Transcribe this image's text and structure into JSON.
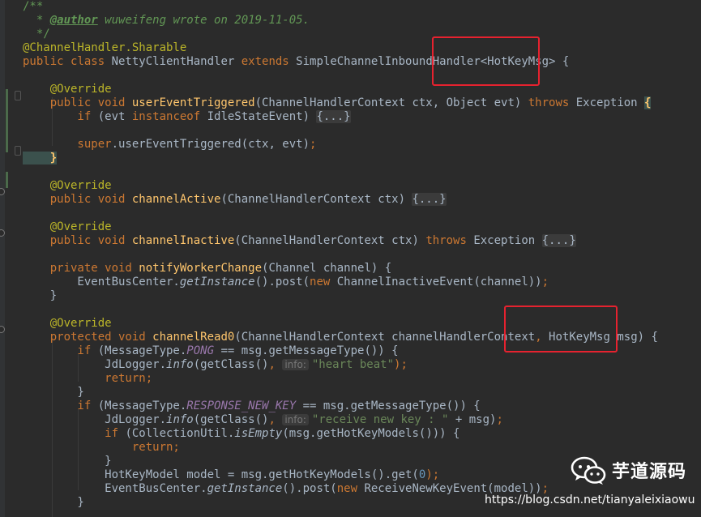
{
  "colors": {
    "background": "#2b2b2b",
    "text": "#a9b7c6",
    "keyword": "#cc7832",
    "method_decl": "#ffc66d",
    "annotation": "#bbb529",
    "string": "#6a8759",
    "number": "#6897bb",
    "static_field": "#9876aa",
    "doc_comment": "#629755",
    "hint_text": "#787878",
    "fold_bg": "#3b3b3b",
    "highlight_box": "#e6222f"
  },
  "code_lines": [
    [
      {
        "t": "/**",
        "c": "doc_comment"
      }
    ],
    [
      {
        "t": "  * ",
        "c": "doc_comment"
      },
      {
        "t": "@author",
        "c": "doc_comment",
        "s": "tag"
      },
      {
        "t": " wuweifeng wrote on 2019-11-05.",
        "c": "doc_comment",
        "s": "italic"
      }
    ],
    [
      {
        "t": "  */",
        "c": "doc_comment"
      }
    ],
    [
      {
        "t": "@ChannelHandler.",
        "c": "annotation"
      },
      {
        "t": "Sharable",
        "c": "annotation"
      }
    ],
    [
      {
        "t": "public class ",
        "c": "keyword"
      },
      {
        "t": "NettyClientHandler ",
        "c": "text"
      },
      {
        "t": "extends ",
        "c": "keyword"
      },
      {
        "t": "SimpleChannelInboundHandler<HotKeyMsg> {",
        "c": "text"
      }
    ],
    [],
    [
      {
        "t": "    @Override",
        "c": "annotation"
      }
    ],
    [
      {
        "t": "    public void ",
        "c": "keyword"
      },
      {
        "t": "userEventTriggered",
        "c": "method_decl"
      },
      {
        "t": "(ChannelHandlerContext ctx, Object evt) ",
        "c": "text"
      },
      {
        "t": "throws ",
        "c": "keyword"
      },
      {
        "t": "Exception ",
        "c": "text"
      },
      {
        "t": "{",
        "c": "method_decl",
        "s": "bold"
      }
    ],
    [
      {
        "t": "        if ",
        "c": "keyword"
      },
      {
        "t": "(evt ",
        "c": "text"
      },
      {
        "t": "instanceof ",
        "c": "keyword"
      },
      {
        "t": "IdleStateEvent) ",
        "c": "text"
      },
      {
        "t": "{...}",
        "c": "text",
        "s": "fold"
      }
    ],
    [],
    [
      {
        "t": "        super",
        "c": "keyword"
      },
      {
        "t": ".userEventTriggered(ctx, evt)",
        "c": "text"
      },
      {
        "t": ";",
        "c": "keyword"
      }
    ],
    [
      {
        "t": "    }",
        "c": "method_decl",
        "s": "bold"
      }
    ],
    [],
    [
      {
        "t": "    @Override",
        "c": "annotation"
      }
    ],
    [
      {
        "t": "    public void ",
        "c": "keyword"
      },
      {
        "t": "channelActive",
        "c": "method_decl"
      },
      {
        "t": "(ChannelHandlerContext ctx) ",
        "c": "text"
      },
      {
        "t": "{...}",
        "c": "text",
        "s": "fold"
      }
    ],
    [],
    [
      {
        "t": "    @Override",
        "c": "annotation"
      }
    ],
    [
      {
        "t": "    public void ",
        "c": "keyword"
      },
      {
        "t": "channelInactive",
        "c": "method_decl"
      },
      {
        "t": "(ChannelHandlerContext ctx) ",
        "c": "text"
      },
      {
        "t": "throws ",
        "c": "keyword"
      },
      {
        "t": "Exception ",
        "c": "text"
      },
      {
        "t": "{...}",
        "c": "text",
        "s": "fold"
      }
    ],
    [],
    [
      {
        "t": "    private void ",
        "c": "keyword"
      },
      {
        "t": "notifyWorkerChange",
        "c": "method_decl"
      },
      {
        "t": "(Channel channel) {",
        "c": "text"
      }
    ],
    [
      {
        "t": "        EventBusCenter.",
        "c": "text"
      },
      {
        "t": "getInstance",
        "c": "text",
        "s": "italic"
      },
      {
        "t": "().post(",
        "c": "text"
      },
      {
        "t": "new ",
        "c": "keyword"
      },
      {
        "t": "ChannelInactiveEvent(channel))",
        "c": "text"
      },
      {
        "t": ";",
        "c": "keyword"
      }
    ],
    [
      {
        "t": "    }",
        "c": "text"
      }
    ],
    [],
    [
      {
        "t": "    @Override",
        "c": "annotation"
      }
    ],
    [
      {
        "t": "    protected void ",
        "c": "keyword"
      },
      {
        "t": "channelRead0",
        "c": "method_decl"
      },
      {
        "t": "(ChannelHandlerContext channelHandlerContext",
        "c": "text"
      },
      {
        "t": ", ",
        "c": "keyword"
      },
      {
        "t": "HotKeyMsg msg) {",
        "c": "text"
      }
    ],
    [
      {
        "t": "        if ",
        "c": "keyword"
      },
      {
        "t": "(MessageType.",
        "c": "text"
      },
      {
        "t": "PONG",
        "c": "static_field",
        "s": "italic"
      },
      {
        "t": " == msg.getMessageType()) {",
        "c": "text"
      }
    ],
    [
      {
        "t": "            JdLogger.",
        "c": "text"
      },
      {
        "t": "info",
        "c": "text",
        "s": "italic"
      },
      {
        "t": "(getClass()",
        "c": "text"
      },
      {
        "t": ", ",
        "c": "keyword"
      },
      {
        "t": "info:",
        "c": "hint_text",
        "s": "hint"
      },
      {
        "t": "\"heart beat\"",
        "c": "string"
      },
      {
        "t": ");",
        "c": "keyword"
      }
    ],
    [
      {
        "t": "            return;",
        "c": "keyword"
      }
    ],
    [
      {
        "t": "        }",
        "c": "text"
      }
    ],
    [
      {
        "t": "        if ",
        "c": "keyword"
      },
      {
        "t": "(MessageType.",
        "c": "text"
      },
      {
        "t": "RESPONSE_NEW_KEY",
        "c": "static_field",
        "s": "italic"
      },
      {
        "t": " == msg.getMessageType()) {",
        "c": "text"
      }
    ],
    [
      {
        "t": "            JdLogger.",
        "c": "text"
      },
      {
        "t": "info",
        "c": "text",
        "s": "italic"
      },
      {
        "t": "(getClass()",
        "c": "text"
      },
      {
        "t": ", ",
        "c": "keyword"
      },
      {
        "t": "info:",
        "c": "hint_text",
        "s": "hint"
      },
      {
        "t": "\"receive new key : \"",
        "c": "string"
      },
      {
        "t": " + msg)",
        "c": "text"
      },
      {
        "t": ";",
        "c": "keyword"
      }
    ],
    [
      {
        "t": "            if ",
        "c": "keyword"
      },
      {
        "t": "(CollectionUtil.",
        "c": "text"
      },
      {
        "t": "isEmpty",
        "c": "text",
        "s": "italic"
      },
      {
        "t": "(msg.getHotKeyModels())) {",
        "c": "text"
      }
    ],
    [
      {
        "t": "                return;",
        "c": "keyword"
      }
    ],
    [
      {
        "t": "            }",
        "c": "text"
      }
    ],
    [
      {
        "t": "            HotKeyModel model = msg.getHotKeyModels().get(",
        "c": "text"
      },
      {
        "t": "0",
        "c": "number"
      },
      {
        "t": ");",
        "c": "keyword"
      }
    ],
    [
      {
        "t": "            EventBusCenter.",
        "c": "text"
      },
      {
        "t": "getInstance",
        "c": "text",
        "s": "italic"
      },
      {
        "t": "().post(",
        "c": "text"
      },
      {
        "t": "new ",
        "c": "keyword"
      },
      {
        "t": "ReceiveNewKeyEvent(model))",
        "c": "text"
      },
      {
        "t": ";",
        "c": "keyword"
      }
    ],
    [
      {
        "t": "        }",
        "c": "text"
      }
    ]
  ],
  "watermark": {
    "logo_icon": "wechat-logo-icon",
    "title": "芋道源码",
    "url": "https://blog.csdn.net/tianyaleixiaowu"
  }
}
